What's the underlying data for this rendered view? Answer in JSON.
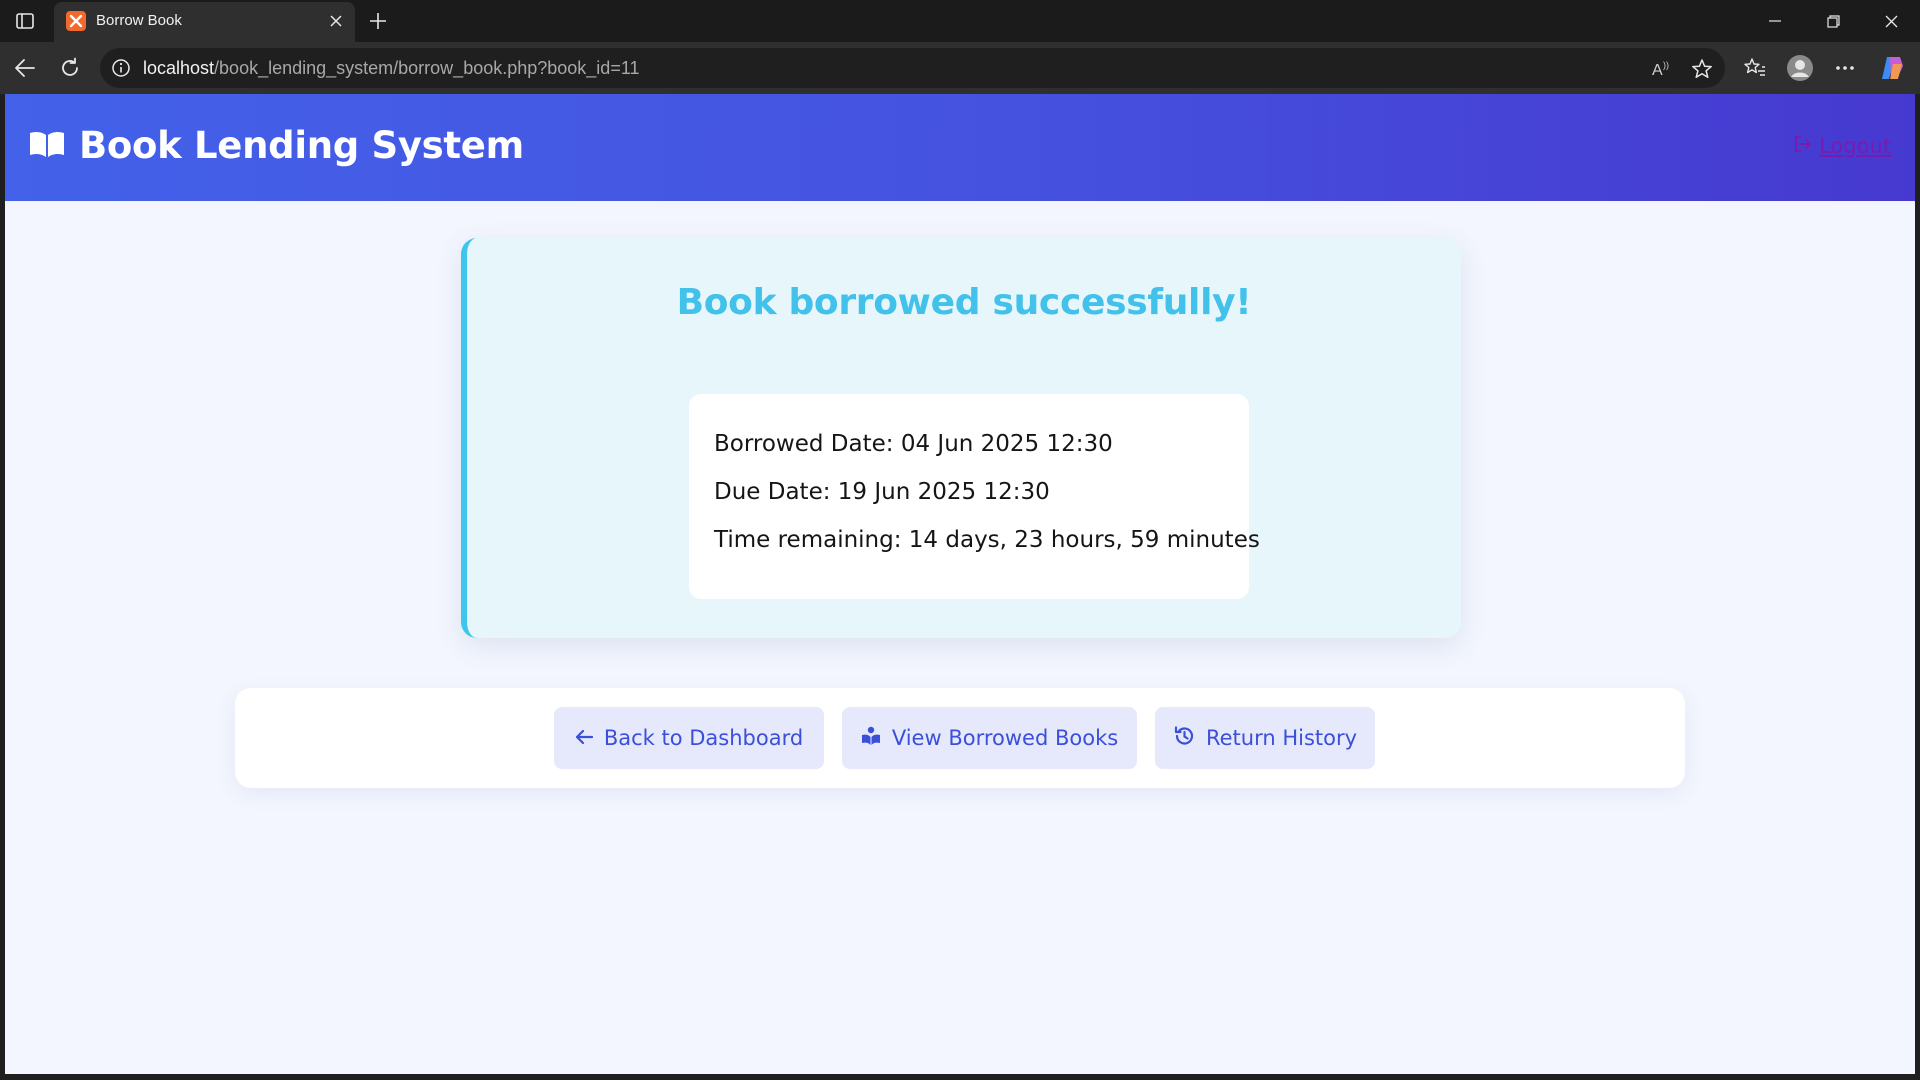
{
  "browser": {
    "tab_title": "Borrow Book",
    "url_host": "localhost",
    "url_path": "/book_lending_system/borrow_book.php?book_id=11"
  },
  "header": {
    "brand": "Book Lending System",
    "logout_label": "Logout"
  },
  "message": {
    "title": "Book borrowed successfully!",
    "borrowed_date": "Borrowed Date: 04 Jun 2025 12:30",
    "due_date": "Due Date: 19 Jun 2025 12:30",
    "time_remaining": "Time remaining: 14 days, 23 hours, 59 minutes"
  },
  "actions": {
    "back": "Back to Dashboard",
    "view_borrowed": "View Borrowed Books",
    "return_history": "Return History"
  },
  "colors": {
    "header_start": "#4361e9",
    "header_end": "#4639d0",
    "success": "#42c1ea",
    "button_text": "#3b4fd8",
    "button_bg": "#e6e9fc"
  }
}
